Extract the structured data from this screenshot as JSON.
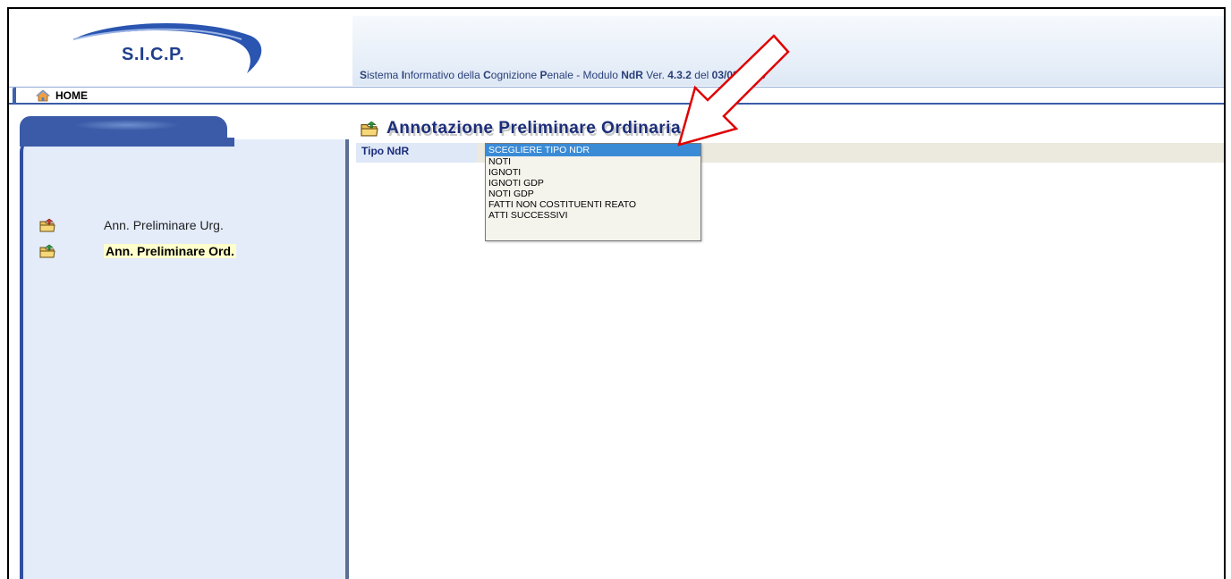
{
  "header": {
    "logo_text": "S.I.C.P.",
    "title_parts": [
      {
        "text": "S",
        "cap": true
      },
      {
        "text": "istema ",
        "cap": false
      },
      {
        "text": "I",
        "cap": true
      },
      {
        "text": "nformativo della ",
        "cap": false
      },
      {
        "text": "C",
        "cap": true
      },
      {
        "text": "ognizione ",
        "cap": false
      },
      {
        "text": "P",
        "cap": true
      },
      {
        "text": "enale - Modulo ",
        "cap": false
      },
      {
        "text": "NdR",
        "cap": true
      },
      {
        "text": " Ver. ",
        "cap": false
      },
      {
        "text": "4.3.2",
        "cap": true
      },
      {
        "text": " del ",
        "cap": false
      },
      {
        "text": "03/03/2023",
        "cap": true
      }
    ]
  },
  "homebar": {
    "home_label": "HOME",
    "icon": "home-icon"
  },
  "sidebar": {
    "items": [
      {
        "label": "Ann. Preliminare Urg.",
        "icon": "folder-icon",
        "active": false
      },
      {
        "label": "Ann. Preliminare Ord.",
        "icon": "folder-icon",
        "active": true
      }
    ]
  },
  "main": {
    "page_title": "Annotazione Preliminare Ordinaria",
    "field_label": "Tipo NdR",
    "select": {
      "selected": "SCEGLIERE TIPO NDR",
      "options": [
        "SCEGLIERE TIPO NDR",
        "NOTI",
        "IGNOTI",
        "IGNOTI GDP",
        "NOTI GDP",
        "FATTI NON COSTITUENTI REATO",
        "ATTI SUCCESSIVI"
      ]
    }
  },
  "colors": {
    "brand_blue": "#1f3f8c",
    "sidebar_bg": "#e4ecfa",
    "active_highlight": "#ffffcc",
    "selected_option": "#3a8bd6",
    "annotation_arrow": "#e00000"
  }
}
